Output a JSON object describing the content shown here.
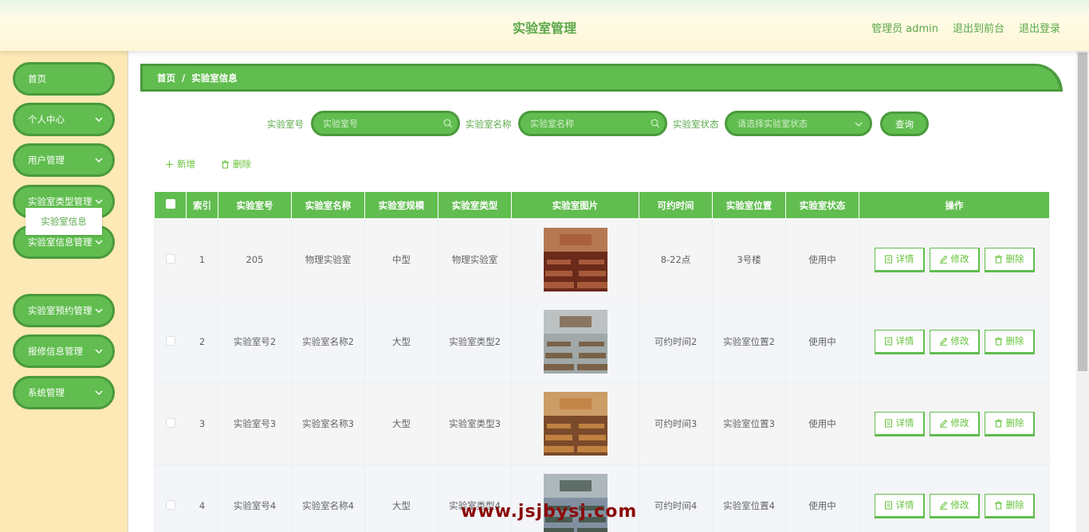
{
  "header": {
    "title": "实验室管理",
    "admin_label": "管理员 admin",
    "back_to_front": "退出到前台",
    "logout": "退出登录"
  },
  "sidebar": {
    "items": [
      {
        "label": "首页",
        "has_children": false
      },
      {
        "label": "个人中心",
        "has_children": true
      },
      {
        "label": "用户管理",
        "has_children": true
      },
      {
        "label": "实验室类型管理",
        "has_children": true
      },
      {
        "label": "实验室信息管理",
        "has_children": true
      },
      {
        "label": "实验室预约管理",
        "has_children": true
      },
      {
        "label": "报修信息管理",
        "has_children": true
      },
      {
        "label": "系统管理",
        "has_children": true
      }
    ],
    "active_submenu": "实验室信息"
  },
  "breadcrumb": {
    "home": "首页",
    "separator": "/",
    "current": "实验室信息"
  },
  "search": {
    "lab_no_label": "实验室号",
    "lab_no_placeholder": "实验室号",
    "lab_name_label": "实验室名称",
    "lab_name_placeholder": "实验室名称",
    "lab_status_label": "实验室状态",
    "lab_status_placeholder": "请选择实验室状态",
    "query_button": "查询"
  },
  "actions": {
    "add": "新增",
    "delete": "删除"
  },
  "table": {
    "columns": [
      "索引",
      "实验室号",
      "实验室名称",
      "实验室规模",
      "实验室类型",
      "实验室图片",
      "可约时间",
      "实验室位置",
      "实验室状态",
      "操作"
    ],
    "rows": [
      {
        "index": "1",
        "lab_no": "205",
        "name": "物理实验室",
        "scale": "中型",
        "type": "物理实验室",
        "time": "8-22点",
        "location": "3号楼",
        "status": "使用中"
      },
      {
        "index": "2",
        "lab_no": "实验室号2",
        "name": "实验室名称2",
        "scale": "大型",
        "type": "实验室类型2",
        "time": "可约时间2",
        "location": "实验室位置2",
        "status": "使用中"
      },
      {
        "index": "3",
        "lab_no": "实验室号3",
        "name": "实验室名称3",
        "scale": "大型",
        "type": "实验室类型3",
        "time": "可约时间3",
        "location": "实验室位置3",
        "status": "使用中"
      },
      {
        "index": "4",
        "lab_no": "实验室号4",
        "name": "实验室名称4",
        "scale": "大型",
        "type": "实验室类型4",
        "time": "可约时间4",
        "location": "实验室位置4",
        "status": "使用中"
      }
    ],
    "op_detail": "详情",
    "op_edit": "修改",
    "op_delete": "删除"
  },
  "watermark": "www.jsjbysj.com",
  "colors": {
    "primary": "#61bd4f",
    "primary_dark": "#4a9a3c",
    "sidebar_bg": "#fde9b5",
    "watermark": "#8b0a0a"
  }
}
